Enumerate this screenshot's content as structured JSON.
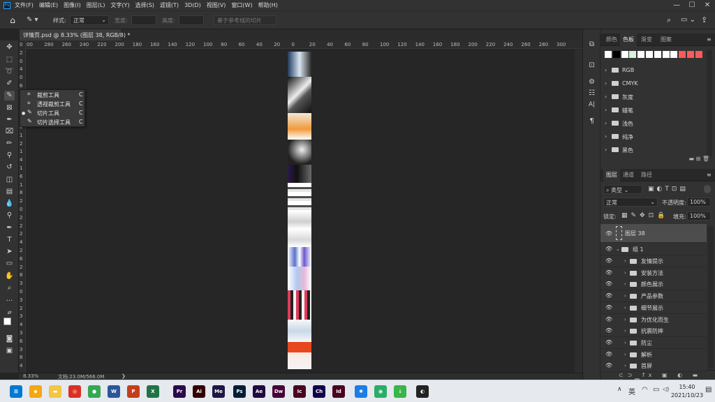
{
  "menubar": {
    "items": [
      "文件(F)",
      "编辑(E)",
      "图像(I)",
      "图层(L)",
      "文字(Y)",
      "选择(S)",
      "滤镜(T)",
      "3D(D)",
      "视图(V)",
      "窗口(W)",
      "帮助(H)"
    ],
    "minimize": "—",
    "maximize": "☐",
    "close": "✕"
  },
  "options": {
    "style_label": "样式:",
    "style_value": "正常",
    "width_label": "宽度:",
    "height_label": "高度:",
    "guides_button": "基于参考线的切片"
  },
  "document": {
    "tab_title": "详情页.psd @ 8.33% (图层 38, RGB/8) *",
    "close": "×"
  },
  "ruler": {
    "top": [
      "00",
      "280",
      "260",
      "240",
      "220",
      "200",
      "180",
      "160",
      "140",
      "120",
      "100",
      "80",
      "60",
      "40",
      "20",
      "0",
      "20",
      "40",
      "60",
      "80",
      "100",
      "120",
      "140",
      "160",
      "180",
      "200",
      "220",
      "240",
      "260",
      "280",
      "300"
    ],
    "left": [
      "0",
      "2",
      "0",
      "4",
      "0",
      "6",
      "0",
      "8",
      "0",
      "1",
      "0",
      "1",
      "2",
      "1",
      "4",
      "1",
      "6",
      "1",
      "8",
      "2",
      "0",
      "2",
      "2",
      "2",
      "4",
      "2",
      "6",
      "2",
      "8",
      "3",
      "0",
      "3",
      "2",
      "3",
      "4",
      "3",
      "6",
      "3",
      "8",
      "4"
    ]
  },
  "flyout": {
    "items": [
      {
        "icon": "⌗",
        "label": "裁剪工具",
        "key": "C",
        "selected": false
      },
      {
        "icon": "⌗",
        "label": "透视裁剪工具",
        "key": "C",
        "selected": false
      },
      {
        "icon": "✎",
        "label": "切片工具",
        "key": "C",
        "selected": true
      },
      {
        "icon": "✎",
        "label": "切片选择工具",
        "key": "C",
        "selected": false
      }
    ]
  },
  "status": {
    "zoom": "8.33%",
    "doc": "文档:23.0M/566.0M",
    "arrow": "❯"
  },
  "swatches_panel": {
    "tabs": [
      "颜色",
      "色板",
      "渐变",
      "图案"
    ],
    "active_tab": "色板",
    "colors": [
      "#ffffff",
      "#000000",
      "#ffffff",
      "#d9f2d9",
      "#ffffff",
      "#ffffff",
      "#ffffff",
      "#ffffff",
      "#ffffff",
      "#ff5a5a",
      "#ff5a5a",
      "#ff5a5a"
    ],
    "groups": [
      "RGB",
      "CMYK",
      "灰度",
      "蜡笔",
      "浅色",
      "纯净",
      "黑色"
    ]
  },
  "layers_panel": {
    "tabs": [
      "图层",
      "通道",
      "路径"
    ],
    "active_tab": "图层",
    "filter_label": "类型",
    "blend_mode": "正常",
    "opacity_label": "不透明度:",
    "opacity_value": "100%",
    "lock_label": "锁定:",
    "fill_label": "填充:",
    "fill_value": "100%",
    "selected_layer": "图层 38",
    "group_name": "组 1",
    "sub_groups": [
      "友情提示",
      "安装方法",
      "颜色展示",
      "产品参数",
      "细节展示",
      "为优化而生",
      "抗震防摔",
      "防尘",
      "解析",
      "首屏"
    ]
  },
  "taskbar": {
    "apps": [
      {
        "label": "⊞",
        "color": "#0078d4"
      },
      {
        "label": "◆",
        "color": "#f3a712"
      },
      {
        "label": "▬",
        "color": "#f2c744"
      },
      {
        "label": "◎",
        "color": "#d93025"
      },
      {
        "label": "●",
        "color": "#34a853"
      },
      {
        "label": "W",
        "color": "#2b579a"
      },
      {
        "label": "P",
        "color": "#c43e1c"
      },
      {
        "label": "X",
        "color": "#217346"
      },
      {
        "label": "Pr",
        "color": "#2a0a4a"
      },
      {
        "label": "Ai",
        "color": "#330000"
      },
      {
        "label": "Me",
        "color": "#1d1646"
      },
      {
        "label": "Ps",
        "color": "#001e36"
      },
      {
        "label": "Ae",
        "color": "#1f0740"
      },
      {
        "label": "Dw",
        "color": "#470137"
      },
      {
        "label": "Ic",
        "color": "#49021f"
      },
      {
        "label": "Ch",
        "color": "#13004a"
      },
      {
        "label": "Id",
        "color": "#49021f"
      },
      {
        "label": "✱",
        "color": "#1a7ee6"
      },
      {
        "label": "◉",
        "color": "#2aae67"
      },
      {
        "label": "↓",
        "color": "#39b54a"
      },
      {
        "label": "◐",
        "color": "#222222"
      }
    ],
    "tray": {
      "caret": "∧",
      "ime": "英",
      "wifi": "◠",
      "battery": "▭",
      "speaker": "◁)",
      "notify": "▤"
    },
    "time": "15:40",
    "date": "2021/10/23"
  }
}
